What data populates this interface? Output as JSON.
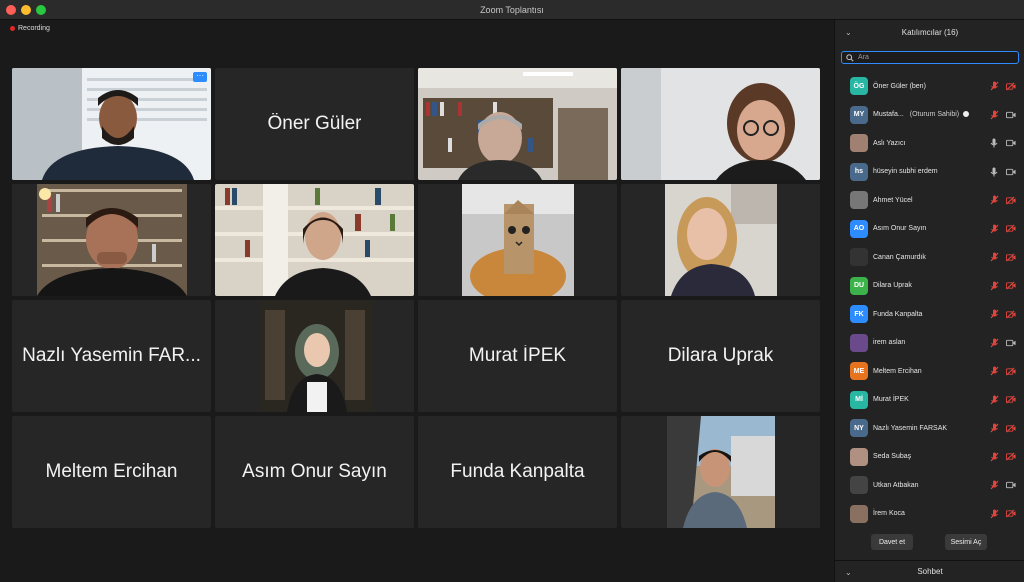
{
  "window": {
    "title": "Zoom Toplantısı"
  },
  "recording": {
    "label": "Recording"
  },
  "tiles": {
    "oner": "Öner Güler",
    "nazli": "Nazlı Yasemin FAR...",
    "murat": "Murat İPEK",
    "dilara": "Dilara Uprak",
    "meltem": "Meltem Ercihan",
    "asim": "Asım Onur Sayın",
    "funda": "Funda Kanpalta",
    "more_label": "···"
  },
  "participants": {
    "header": "Katılımcılar (16)",
    "search_placeholder": "Ara",
    "list": [
      {
        "initials": "ÖG",
        "name": "Öner Güler (ben)",
        "color": "#28b7a3"
      },
      {
        "initials": "MY",
        "name": "Mustafa...",
        "role": "(Oturum Sahibi)",
        "color": "#4a6a8c"
      },
      {
        "initials": "",
        "name": "Aslı Yazıcı",
        "color": "#a08070"
      },
      {
        "initials": "hs",
        "name": "hüseyin subhi erdem",
        "color": "#4a6a8c"
      },
      {
        "initials": "",
        "name": "Ahmet Yücel",
        "color": "#777777"
      },
      {
        "initials": "AO",
        "name": "Asım Onur Sayın",
        "color": "#2d8cff"
      },
      {
        "initials": "",
        "name": "Canan Çamurdık",
        "color": "#333333"
      },
      {
        "initials": "DU",
        "name": "Dilara Uprak",
        "color": "#3cb34a"
      },
      {
        "initials": "FK",
        "name": "Funda Kanpalta",
        "color": "#2d8cff"
      },
      {
        "initials": "",
        "name": "irem aslan",
        "color": "#6a4a8a"
      },
      {
        "initials": "ME",
        "name": "Meltem Ercihan",
        "color": "#e6731e"
      },
      {
        "initials": "Mİ",
        "name": "Murat İPEK",
        "color": "#28b7a3"
      },
      {
        "initials": "NY",
        "name": "Nazlı Yasemin FARSAK",
        "color": "#4a6a8c"
      },
      {
        "initials": "",
        "name": "Seda Subaş",
        "color": "#b09080"
      },
      {
        "initials": "",
        "name": "Utkan Atbakan",
        "color": "#444444"
      },
      {
        "initials": "",
        "name": "İrem Koca",
        "color": "#8a7060"
      }
    ],
    "invite_label": "Davet et",
    "unmute_label": "Sesimi Aç"
  },
  "chat": {
    "header": "Sohbet"
  }
}
